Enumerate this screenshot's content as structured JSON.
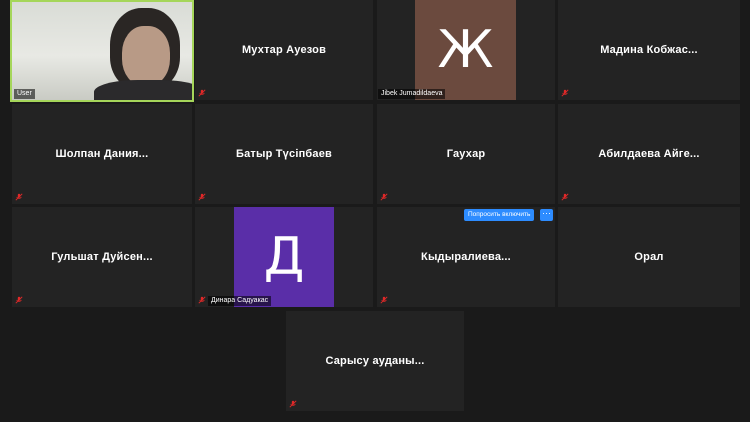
{
  "self": {
    "label": "User"
  },
  "participants": [
    {
      "id": "auezov",
      "name": "Мухтар Ауезов"
    },
    {
      "id": "jibek",
      "name": "Jibek Jumadildaeva",
      "avatar_letter": "Ж",
      "avatar_color": "#6b4a3e"
    },
    {
      "id": "madina",
      "name": "Мадина  Кобжас..."
    },
    {
      "id": "sholpan",
      "name": "Шолпан  Дания..."
    },
    {
      "id": "batyr",
      "name": "Батыр Түсіпбаев"
    },
    {
      "id": "gaukhar",
      "name": "Гаухар"
    },
    {
      "id": "abildaeva",
      "name": "Абилдаева  Айге..."
    },
    {
      "id": "gulshat",
      "name": "Гульшат  Дуйсен..."
    },
    {
      "id": "dinara",
      "name": "Динара Садуакас",
      "avatar_letter": "Д",
      "avatar_color": "#5a2ea8"
    },
    {
      "id": "kydyralieva",
      "name": "Кыдыралиева..."
    },
    {
      "id": "oral",
      "name": "Орал"
    },
    {
      "id": "sarysu",
      "name": "Сарысу  ауданы..."
    }
  ],
  "request": {
    "label": "Попросить включить",
    "more_label": "···"
  },
  "colors": {
    "tile_bg": "#232323",
    "active_speaker_border": "#a5d65a",
    "accent": "#2d8cff",
    "mute_icon": "#e02828"
  },
  "icons": {
    "mute": "microphone-muted-icon"
  }
}
